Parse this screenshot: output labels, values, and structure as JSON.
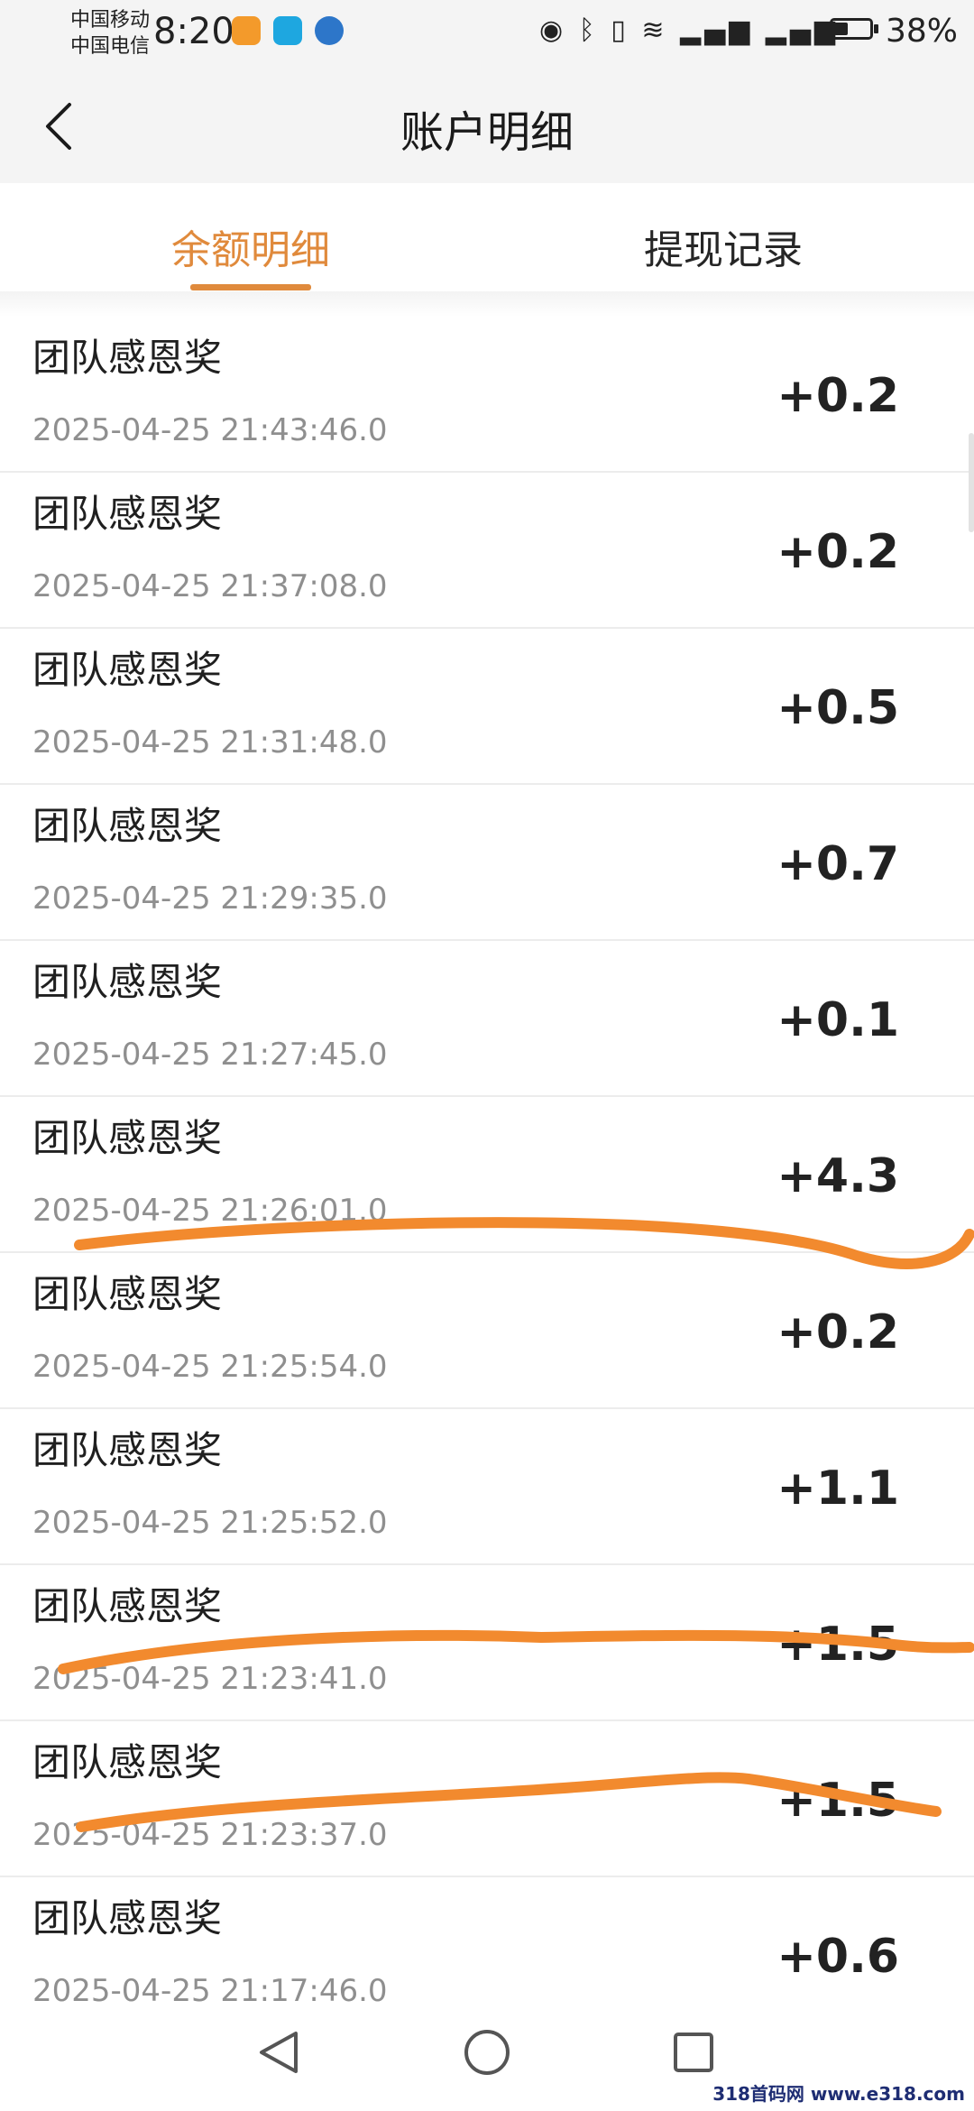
{
  "status_bar": {
    "carrier_1": "中国移动",
    "carrier_2": "中国电信",
    "time": "8:20",
    "battery": "38%",
    "battery_level": 0.38,
    "colors": {
      "app_1": "#f39a2b",
      "app_2": "#1ea7e0",
      "app_3": "#2d76c9"
    }
  },
  "header": {
    "title": "账户明细"
  },
  "tabs": [
    {
      "label": "余额明细",
      "active": true
    },
    {
      "label": "提现记录",
      "active": false
    }
  ],
  "records": [
    {
      "title": "团队感恩奖",
      "time": "2025-04-25 21:43:46.0",
      "amount": "+0.2"
    },
    {
      "title": "团队感恩奖",
      "time": "2025-04-25 21:37:08.0",
      "amount": "+0.2"
    },
    {
      "title": "团队感恩奖",
      "time": "2025-04-25 21:31:48.0",
      "amount": "+0.5"
    },
    {
      "title": "团队感恩奖",
      "time": "2025-04-25 21:29:35.0",
      "amount": "+0.7"
    },
    {
      "title": "团队感恩奖",
      "time": "2025-04-25 21:27:45.0",
      "amount": "+0.1"
    },
    {
      "title": "团队感恩奖",
      "time": "2025-04-25 21:26:01.0",
      "amount": "+4.3"
    },
    {
      "title": "团队感恩奖",
      "time": "2025-04-25 21:25:54.0",
      "amount": "+0.2"
    },
    {
      "title": "团队感恩奖",
      "time": "2025-04-25 21:25:52.0",
      "amount": "+1.1"
    },
    {
      "title": "团队感恩奖",
      "time": "2025-04-25 21:23:41.0",
      "amount": "+1.5"
    },
    {
      "title": "团队感恩奖",
      "time": "2025-04-25 21:23:37.0",
      "amount": "+1.5"
    },
    {
      "title": "团队感恩奖",
      "time": "2025-04-25 21:17:46.0",
      "amount": "+0.6"
    }
  ],
  "watermark": "318首码网 www.e318.com",
  "colors": {
    "accent": "#e08a3c",
    "annotation": "#f28a2e"
  }
}
